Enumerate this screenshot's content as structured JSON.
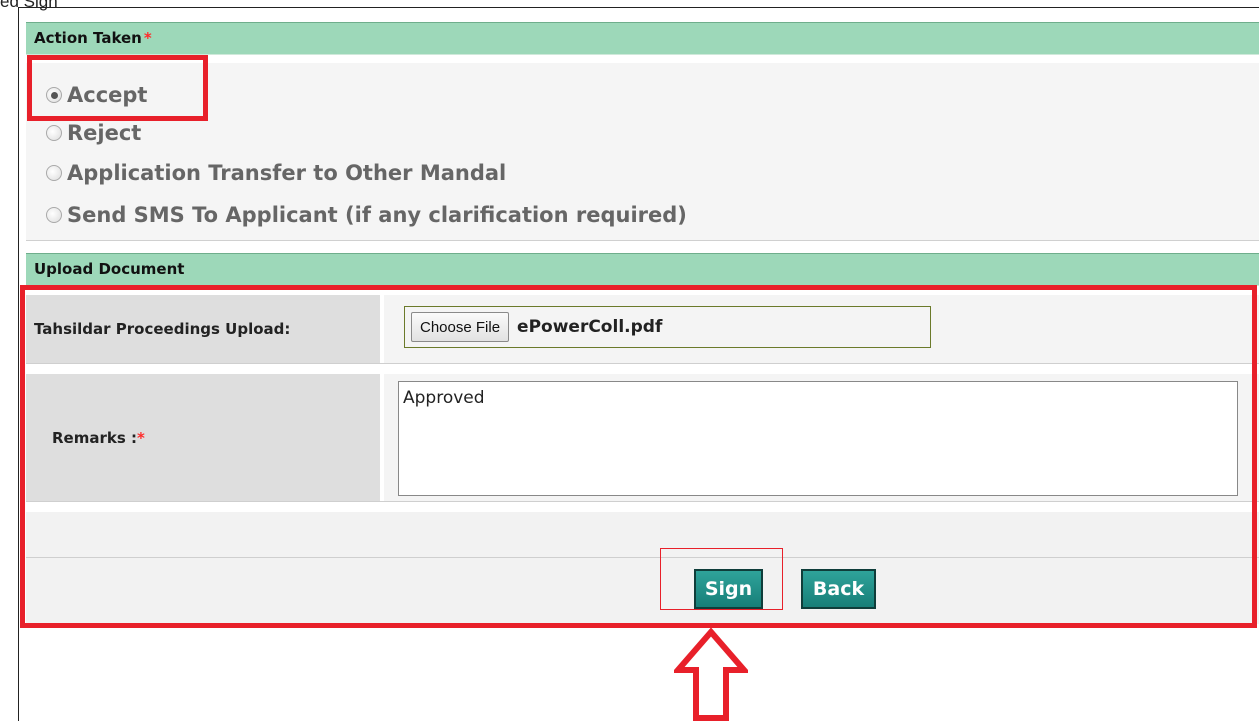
{
  "caption": "ed Sign",
  "action_taken": {
    "title": "Action Taken",
    "required_mark": "*",
    "options": [
      {
        "label": "Accept",
        "checked": true
      },
      {
        "label": "Reject",
        "checked": false
      },
      {
        "label": "Application Transfer to Other Mandal",
        "checked": false
      },
      {
        "label": "Send SMS To Applicant (if any clarification required)",
        "checked": false
      }
    ]
  },
  "upload_document": {
    "title": "Upload Document",
    "upload_label": "Tahsildar Proceedings Upload:",
    "choose_file_label": "Choose File",
    "file_name": "ePowerColl.pdf",
    "remarks_label": "Remarks :",
    "remarks_required_mark": "*",
    "remarks_value": "Approved"
  },
  "buttons": {
    "sign": "Sign",
    "back": "Back"
  },
  "colors": {
    "section_header": "#9dd8b9",
    "highlight": "#e8202a",
    "button": "#1e8f87"
  }
}
